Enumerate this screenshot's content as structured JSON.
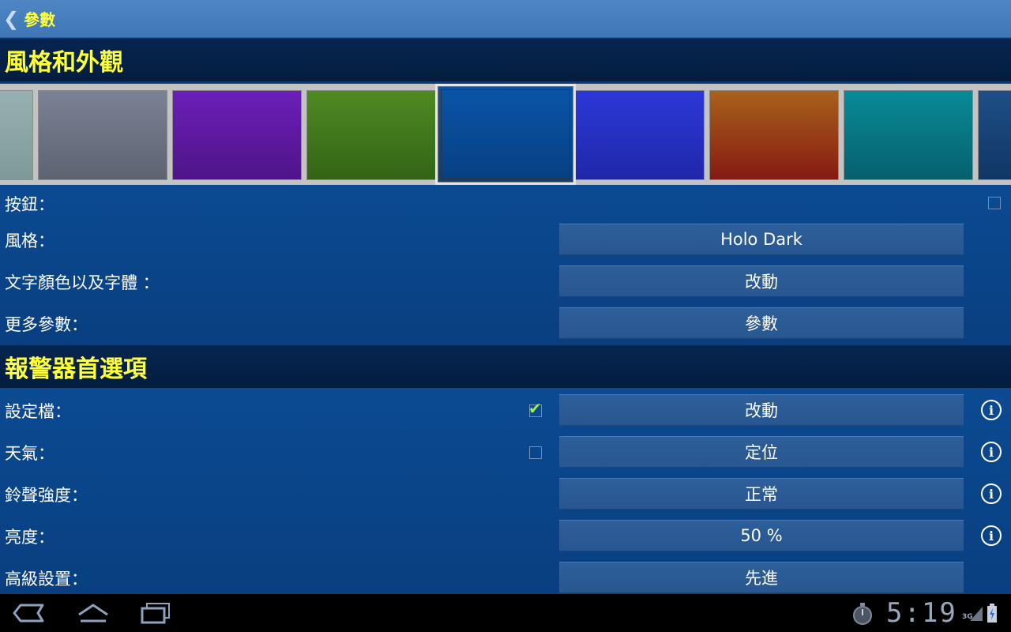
{
  "topbar": {
    "back_label": "參數"
  },
  "sections": {
    "appearance": "風格和外觀",
    "alarm": "報警器首選項"
  },
  "swatches": [
    {
      "name": "teal-grey",
      "from": "#98b0b0",
      "to": "#7f9999"
    },
    {
      "name": "grey",
      "from": "#7a8294",
      "to": "#5c6472"
    },
    {
      "name": "purple",
      "from": "#6c1fb8",
      "to": "#4e1488"
    },
    {
      "name": "green",
      "from": "#4f8a22",
      "to": "#336416"
    },
    {
      "name": "blue",
      "from": "#0a55a8",
      "to": "#073f82",
      "selected": true
    },
    {
      "name": "indigo",
      "from": "#2c38d8",
      "to": "#1f27a8"
    },
    {
      "name": "orange",
      "from": "#a8621c",
      "to": "#861a12"
    },
    {
      "name": "cyan",
      "from": "#0a8a98",
      "to": "#06606c"
    },
    {
      "name": "navy",
      "from": "#1e4f86",
      "to": "#103664"
    }
  ],
  "appearance_rows": [
    {
      "label": "按鈕：",
      "checkbox": false
    },
    {
      "label": "風格：",
      "value": "Holo Dark"
    },
    {
      "label": "文字顏色以及字體 ：",
      "value": "改動"
    },
    {
      "label": "更多參數：",
      "value": "參數"
    }
  ],
  "alarm_rows": [
    {
      "label": "設定檔：",
      "checkbox": true,
      "value": "改動",
      "info": true
    },
    {
      "label": "天氣：",
      "checkbox": false,
      "value": "定位",
      "info": true
    },
    {
      "label": "鈴聲強度：",
      "value": "正常",
      "info": true
    },
    {
      "label": "亮度：",
      "value": "50 %",
      "info": true
    },
    {
      "label": "高級設置：",
      "value": "先進",
      "info": false
    }
  ],
  "status": {
    "time": "5:19",
    "network": "3G"
  },
  "icons": {
    "info": "i",
    "back": "❮"
  }
}
